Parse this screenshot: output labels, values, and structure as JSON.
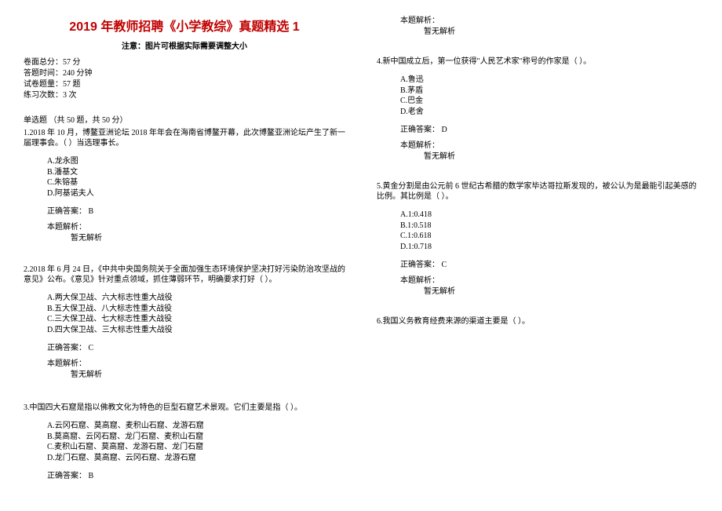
{
  "title": "2019 年教师招聘《小学教综》真题精选 1",
  "note": "注意：图片可根据实际需要调整大小",
  "meta": {
    "total_score": "卷面总分：57 分",
    "duration": "答题时间：240 分钟",
    "question_count": "试卷题量：57 题",
    "practice_times": "练习次数：3 次"
  },
  "section_header": "单选题 （共 50 题，共 50 分）",
  "questions": [
    {
      "stem": "1.2018 年 10 月，博鳌亚洲论坛 2018 年年会在海南省博鳌开幕，此次博鳌亚洲论坛产生了新一届理事会。（  ）当选理事长。",
      "options": [
        "A.龙永图",
        "B.潘基文",
        "C.朱镕基",
        "D.阿基诺夫人"
      ],
      "answer_label": "正确答案：",
      "answer_value": "B",
      "analysis_label": "本题解析：",
      "analysis_text": "暂无解析"
    },
    {
      "stem": "2.2018 年 6 月 24 日，《中共中央国务院关于全面加强生态环境保护坚决打好污染防治攻坚战的意见》公布。《意见》针对重点领域，抓住薄弱环节，明确要求打好（  ）。",
      "options": [
        "A.两大保卫战、六大标志性重大战役",
        "B.五大保卫战、八大标志性重大战役",
        "C.三大保卫战、七大标志性重大战役",
        "D.四大保卫战、三大标志性重大战役"
      ],
      "answer_label": "正确答案：",
      "answer_value": "C",
      "analysis_label": "本题解析：",
      "analysis_text": "暂无解析"
    },
    {
      "stem": "3.中国四大石窟是指以佛教文化为特色的巨型石窟艺术景观。它们主要是指（  ）。",
      "options": [
        "A.云冈石窟、莫高窟、麦积山石窟、龙游石窟",
        "B.莫高窟、云冈石窟、龙门石窟、麦积山石窟",
        "C.麦积山石窟、莫高窟、龙游石窟、龙门石窟",
        "D.龙门石窟、莫高窟、云冈石窟、龙游石窟"
      ],
      "answer_label": "正确答案：",
      "answer_value": "B",
      "analysis_label": "本题解析：",
      "analysis_text": "暂无解析"
    },
    {
      "stem": "4.新中国成立后，第一位获得\"人民艺术家\"称号的作家是（  ）。",
      "options": [
        "A.鲁迅",
        "B.茅盾",
        "C.巴金",
        "D.老舍"
      ],
      "answer_label": "正确答案：",
      "answer_value": "D",
      "analysis_label": "本题解析：",
      "analysis_text": "暂无解析"
    },
    {
      "stem": "5.黄金分割是由公元前 6 世纪古希腊的数学家毕达哥拉斯发现的，被公认为是最能引起美感的比例。其比例是（  ）。",
      "options": [
        "A.1:0.418",
        "B.1:0.518",
        "C.1:0.618",
        "D.1:0.718"
      ],
      "answer_label": "正确答案：",
      "answer_value": "C",
      "analysis_label": "本题解析：",
      "analysis_text": "暂无解析"
    },
    {
      "stem": "6.我国义务教育经费来源的渠道主要是（  ）。",
      "options": [],
      "answer_label": "",
      "answer_value": "",
      "analysis_label": "",
      "analysis_text": ""
    }
  ]
}
